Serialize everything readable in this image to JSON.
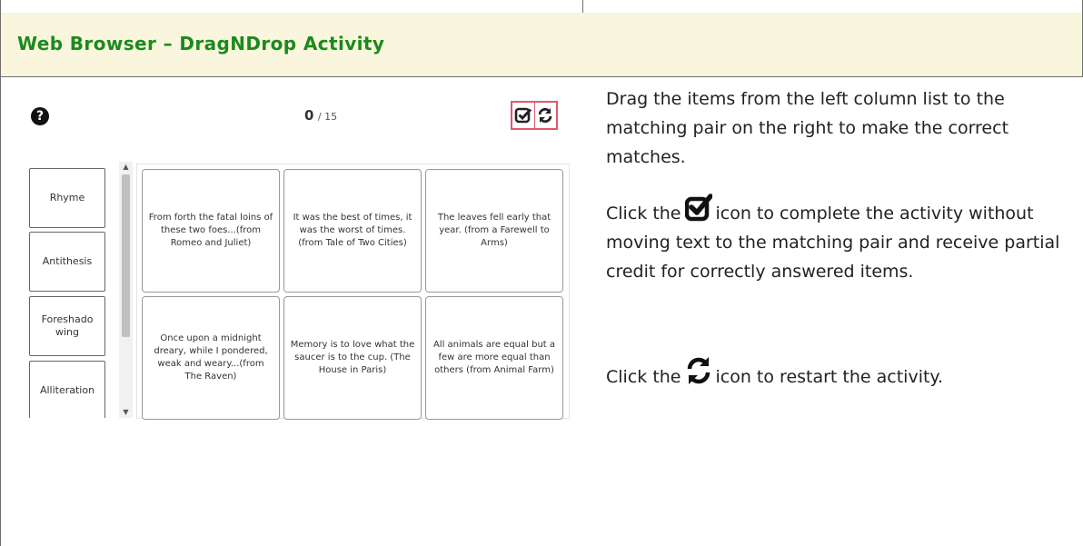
{
  "section": {
    "title": "Web Browser – DragNDrop Activity"
  },
  "activity": {
    "help_icon": "question-circle-icon",
    "score": {
      "current": "0",
      "total": "/ 15"
    },
    "tools": [
      {
        "name": "complete-activity-button",
        "icon": "check-square-icon"
      },
      {
        "name": "restart-activity-button",
        "icon": "refresh-icon"
      }
    ],
    "terms": [
      "Rhyme",
      "Antithesis",
      "Foreshado wing",
      "Alliteration"
    ],
    "targets": [
      "From forth the fatal loins of these two foes...(from Romeo and Juliet)",
      "It was the best of times, it was the worst of times. (from Tale of Two Cities)",
      "The leaves fell early that year. (from a Farewell to Arms)",
      "Once upon a midnight dreary, while I pondered, weak and weary...(from The Raven)",
      "Memory is to love what the saucer is to the cup. (The House in Paris)",
      "All animals are equal but a few are more equal than others (from Animal Farm)"
    ],
    "accent_color": "#e05a6a"
  },
  "instructions": {
    "para1": "Drag the items from the left column list to the matching pair on the right to make the correct matches.",
    "para2_before": "Click the",
    "para2_after": "icon to complete the activity without moving text to the matching pair and receive partial credit for correctly answered items.",
    "para3_before": "Click the",
    "para3_after": "icon to restart the activity."
  },
  "colors": {
    "header_bg": "#f9f6dd",
    "title": "#1c8a1c"
  }
}
